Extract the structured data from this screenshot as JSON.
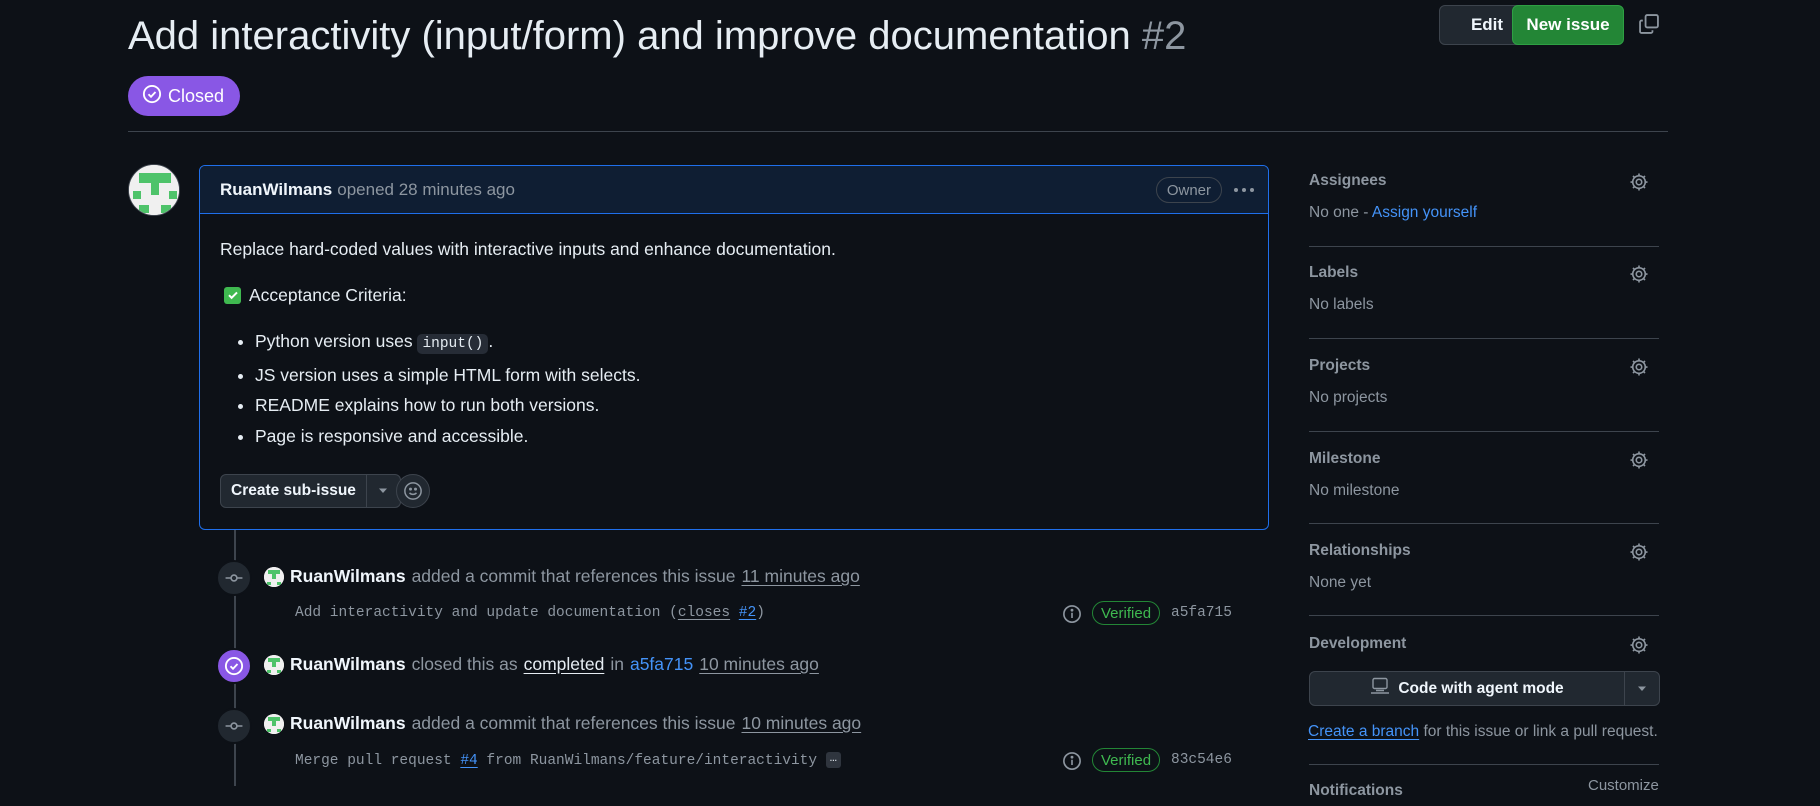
{
  "issue": {
    "title": "Add interactivity (input/form) and improve documentation",
    "number": "#2",
    "state": "Closed",
    "edit_label": "Edit",
    "new_issue_label": "New issue"
  },
  "comment": {
    "author": "RuanWilmans",
    "meta": "opened 28 minutes ago",
    "badge": "Owner",
    "body_intro": "Replace hard-coded values with interactive inputs and enhance documentation.",
    "criteria_title": "Acceptance Criteria:",
    "criteria": [
      {
        "before": "Python version uses ",
        "code": "input()",
        "after": "."
      },
      {
        "text": "JS version uses a simple HTML form with selects."
      },
      {
        "text": "README explains how to run both versions."
      },
      {
        "text": "Page is responsive and accessible."
      }
    ],
    "sub_issue_label": "Create sub-issue"
  },
  "timeline": [
    {
      "author": "RuanWilmans",
      "action": "added a commit that references this issue",
      "time": "11 minutes ago",
      "commit": {
        "msg_a": "Add interactivity and update documentation (",
        "close_word": "closes",
        "ref": "#2",
        "msg_b": ")",
        "verified": "Verified",
        "sha": "a5fa715"
      }
    },
    {
      "author": "RuanWilmans",
      "action_a": "closed this as",
      "status": "completed",
      "action_b": "in",
      "ref": "a5fa715",
      "time": "10 minutes ago"
    },
    {
      "author": "RuanWilmans",
      "action": "added a commit that references this issue",
      "time": "10 minutes ago",
      "commit": {
        "msg_a": "Merge pull request ",
        "ref": "#4",
        "msg_b": " from RuanWilmans/feature/interactivity",
        "ellipsis": "…",
        "verified": "Verified",
        "sha": "83c54e6"
      }
    }
  ],
  "sidebar": {
    "assignees": {
      "title": "Assignees",
      "value": "No one - ",
      "link": "Assign yourself"
    },
    "labels": {
      "title": "Labels",
      "value": "No labels"
    },
    "projects": {
      "title": "Projects",
      "value": "No projects"
    },
    "milestone": {
      "title": "Milestone",
      "value": "No milestone"
    },
    "relationships": {
      "title": "Relationships",
      "value": "None yet"
    },
    "development": {
      "title": "Development",
      "agent_label": "Code with agent mode",
      "branch_link": "Create a branch",
      "branch_rest": " for this issue or link a pull request."
    },
    "notifications": {
      "title": "Notifications",
      "customize": "Customize"
    }
  },
  "colors": {
    "bg": "#0d1117",
    "closed": "#8957e5",
    "accent_green": "#238636",
    "link": "#4493f8",
    "verified": "#3fb950"
  },
  "icons": [
    "issue-closed-icon",
    "copy-icon",
    "kebab-horizontal-icon",
    "checkbox-emoji-icon",
    "triangle-down-icon",
    "smiley-icon",
    "git-commit-icon",
    "check-circle-icon",
    "info-icon",
    "gear-icon",
    "agent-icon"
  ]
}
